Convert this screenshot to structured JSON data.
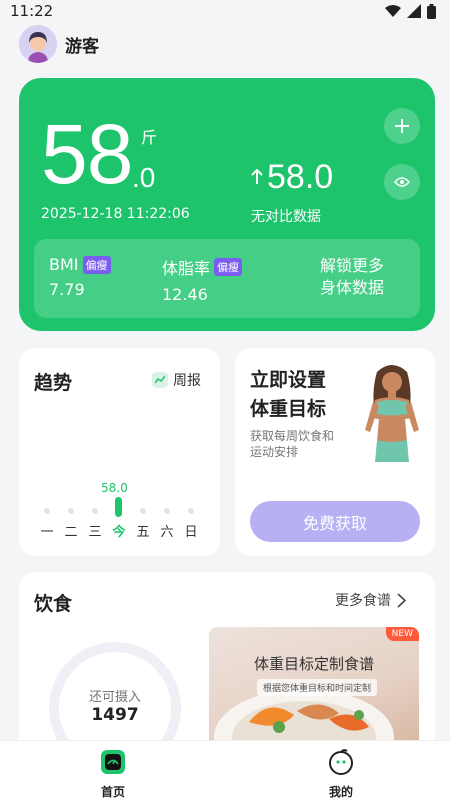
{
  "status_bar": {
    "time": "11:22"
  },
  "user": {
    "name": "游客"
  },
  "weight": {
    "integer": "58",
    "decimal": ".0",
    "unit": "斤",
    "date": "2025-12-18 11:22:06",
    "compare_value": "58.0",
    "compare_label": "无对比数据"
  },
  "metrics": {
    "bmi": {
      "label": "BMI",
      "badge": "偏瘦",
      "value": "7.79"
    },
    "body_fat": {
      "label": "体脂率",
      "badge": "偏瘦",
      "value": "12.46"
    },
    "unlock_line1": "解锁更多",
    "unlock_line2": "身体数据"
  },
  "trend": {
    "title": "趋势",
    "weekly_label": "周报",
    "today_value": "58.0",
    "days": [
      "一",
      "二",
      "三",
      "今",
      "五",
      "六",
      "日"
    ]
  },
  "goal": {
    "title_line1": "立即设置",
    "title_line2": "体重目标",
    "sub_line1": "获取每周饮食和",
    "sub_line2": "运动安排",
    "button": "免费获取"
  },
  "diet": {
    "title": "饮食",
    "more": "更多食谱",
    "ring_label": "还可摄入",
    "ring_value": "1497",
    "banner_title": "体重目标定制食谱",
    "banner_sub": "根据您体重目标和时间定制",
    "banner_badge": "NEW"
  },
  "nav": {
    "home": "首页",
    "mine": "我的"
  },
  "colors": {
    "primary_green": "#1dc46c",
    "badge_purple": "#7a5cf0",
    "goal_button": "#b7b1f3",
    "new_badge": "#ff5a3c"
  }
}
